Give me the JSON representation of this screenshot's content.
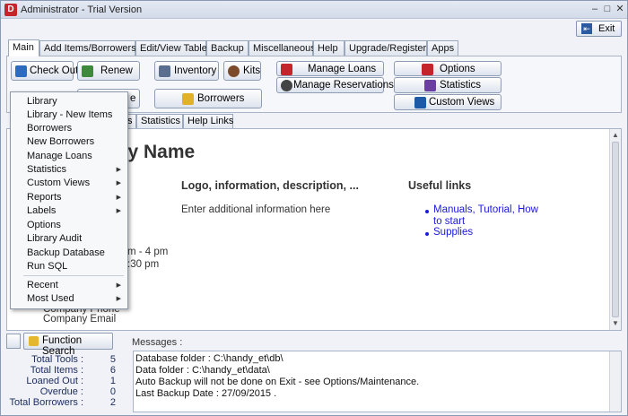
{
  "window": {
    "title": "Administrator - Trial Version",
    "app_icon": "D"
  },
  "toolbar": {
    "exit_label": "Exit"
  },
  "tabs": [
    "Main",
    "Add Items/Borrowers",
    "Edit/View Table",
    "Backup",
    "Miscellaneous",
    "Help",
    "Upgrade/Register",
    "Apps"
  ],
  "ribbon": {
    "check_out": "Check Out",
    "renew": "Renew",
    "inventory": "Inventory",
    "kits": "Kits",
    "borrowers": "Borrowers",
    "manage_loans": "Manage Loans",
    "manage_reservations": "Manage Reservations",
    "options": "Options",
    "statistics": "Statistics",
    "custom_views": "Custom Views",
    "partial_right": "e"
  },
  "subtabs": [
    "s",
    "Statistics",
    "Help Links"
  ],
  "content": {
    "company_name": "any Name",
    "logo_heading": "Logo, information, description, ...",
    "additional_info": "Enter additional information here",
    "useful_links_heading": "Useful links",
    "links": [
      "Manuals, Tutorial, How",
      "to start",
      "Supplies"
    ],
    "hours_1": "m - 4 pm",
    "hours_2": ":30 pm",
    "company_phone": "Company Phone",
    "company_email": "Company Email"
  },
  "context_menu": {
    "items": [
      {
        "label": "Library",
        "arrow": false
      },
      {
        "label": "Library - New Items",
        "arrow": false
      },
      {
        "label": "Borrowers",
        "arrow": false
      },
      {
        "label": "New Borrowers",
        "arrow": false
      },
      {
        "label": "Manage Loans",
        "arrow": false
      },
      {
        "label": "Statistics",
        "arrow": true
      },
      {
        "label": "Custom Views",
        "arrow": true
      },
      {
        "label": "Reports",
        "arrow": true
      },
      {
        "label": "Labels",
        "arrow": true
      },
      {
        "label": "Options",
        "arrow": false
      },
      {
        "label": "Library Audit",
        "arrow": false
      },
      {
        "label": "Backup Database",
        "arrow": false
      },
      {
        "label": "Run SQL",
        "arrow": false
      },
      {
        "label": "Recent",
        "arrow": true
      },
      {
        "label": "Most Used",
        "arrow": true
      }
    ]
  },
  "bottom": {
    "function_search": "Function Search",
    "messages_label": "Messages :"
  },
  "stats": [
    {
      "label": "Total Tools :",
      "value": "5"
    },
    {
      "label": "Total Items :",
      "value": "6"
    },
    {
      "label": "Loaned Out :",
      "value": "1"
    },
    {
      "label": "Overdue :",
      "value": "0"
    },
    {
      "label": "Total Borrowers :",
      "value": "2"
    }
  ],
  "messages": [
    "Database folder : C:\\handy_et\\db\\",
    "Data folder : C:\\handy_et\\data\\",
    "Auto Backup will not be done on Exit - see Options/Maintenance.",
    "Last Backup Date : 27/09/2015 ."
  ],
  "colors": {
    "link": "#1a1adb",
    "stats_text": "#1b2c5f",
    "accent_red": "#c4242b"
  }
}
